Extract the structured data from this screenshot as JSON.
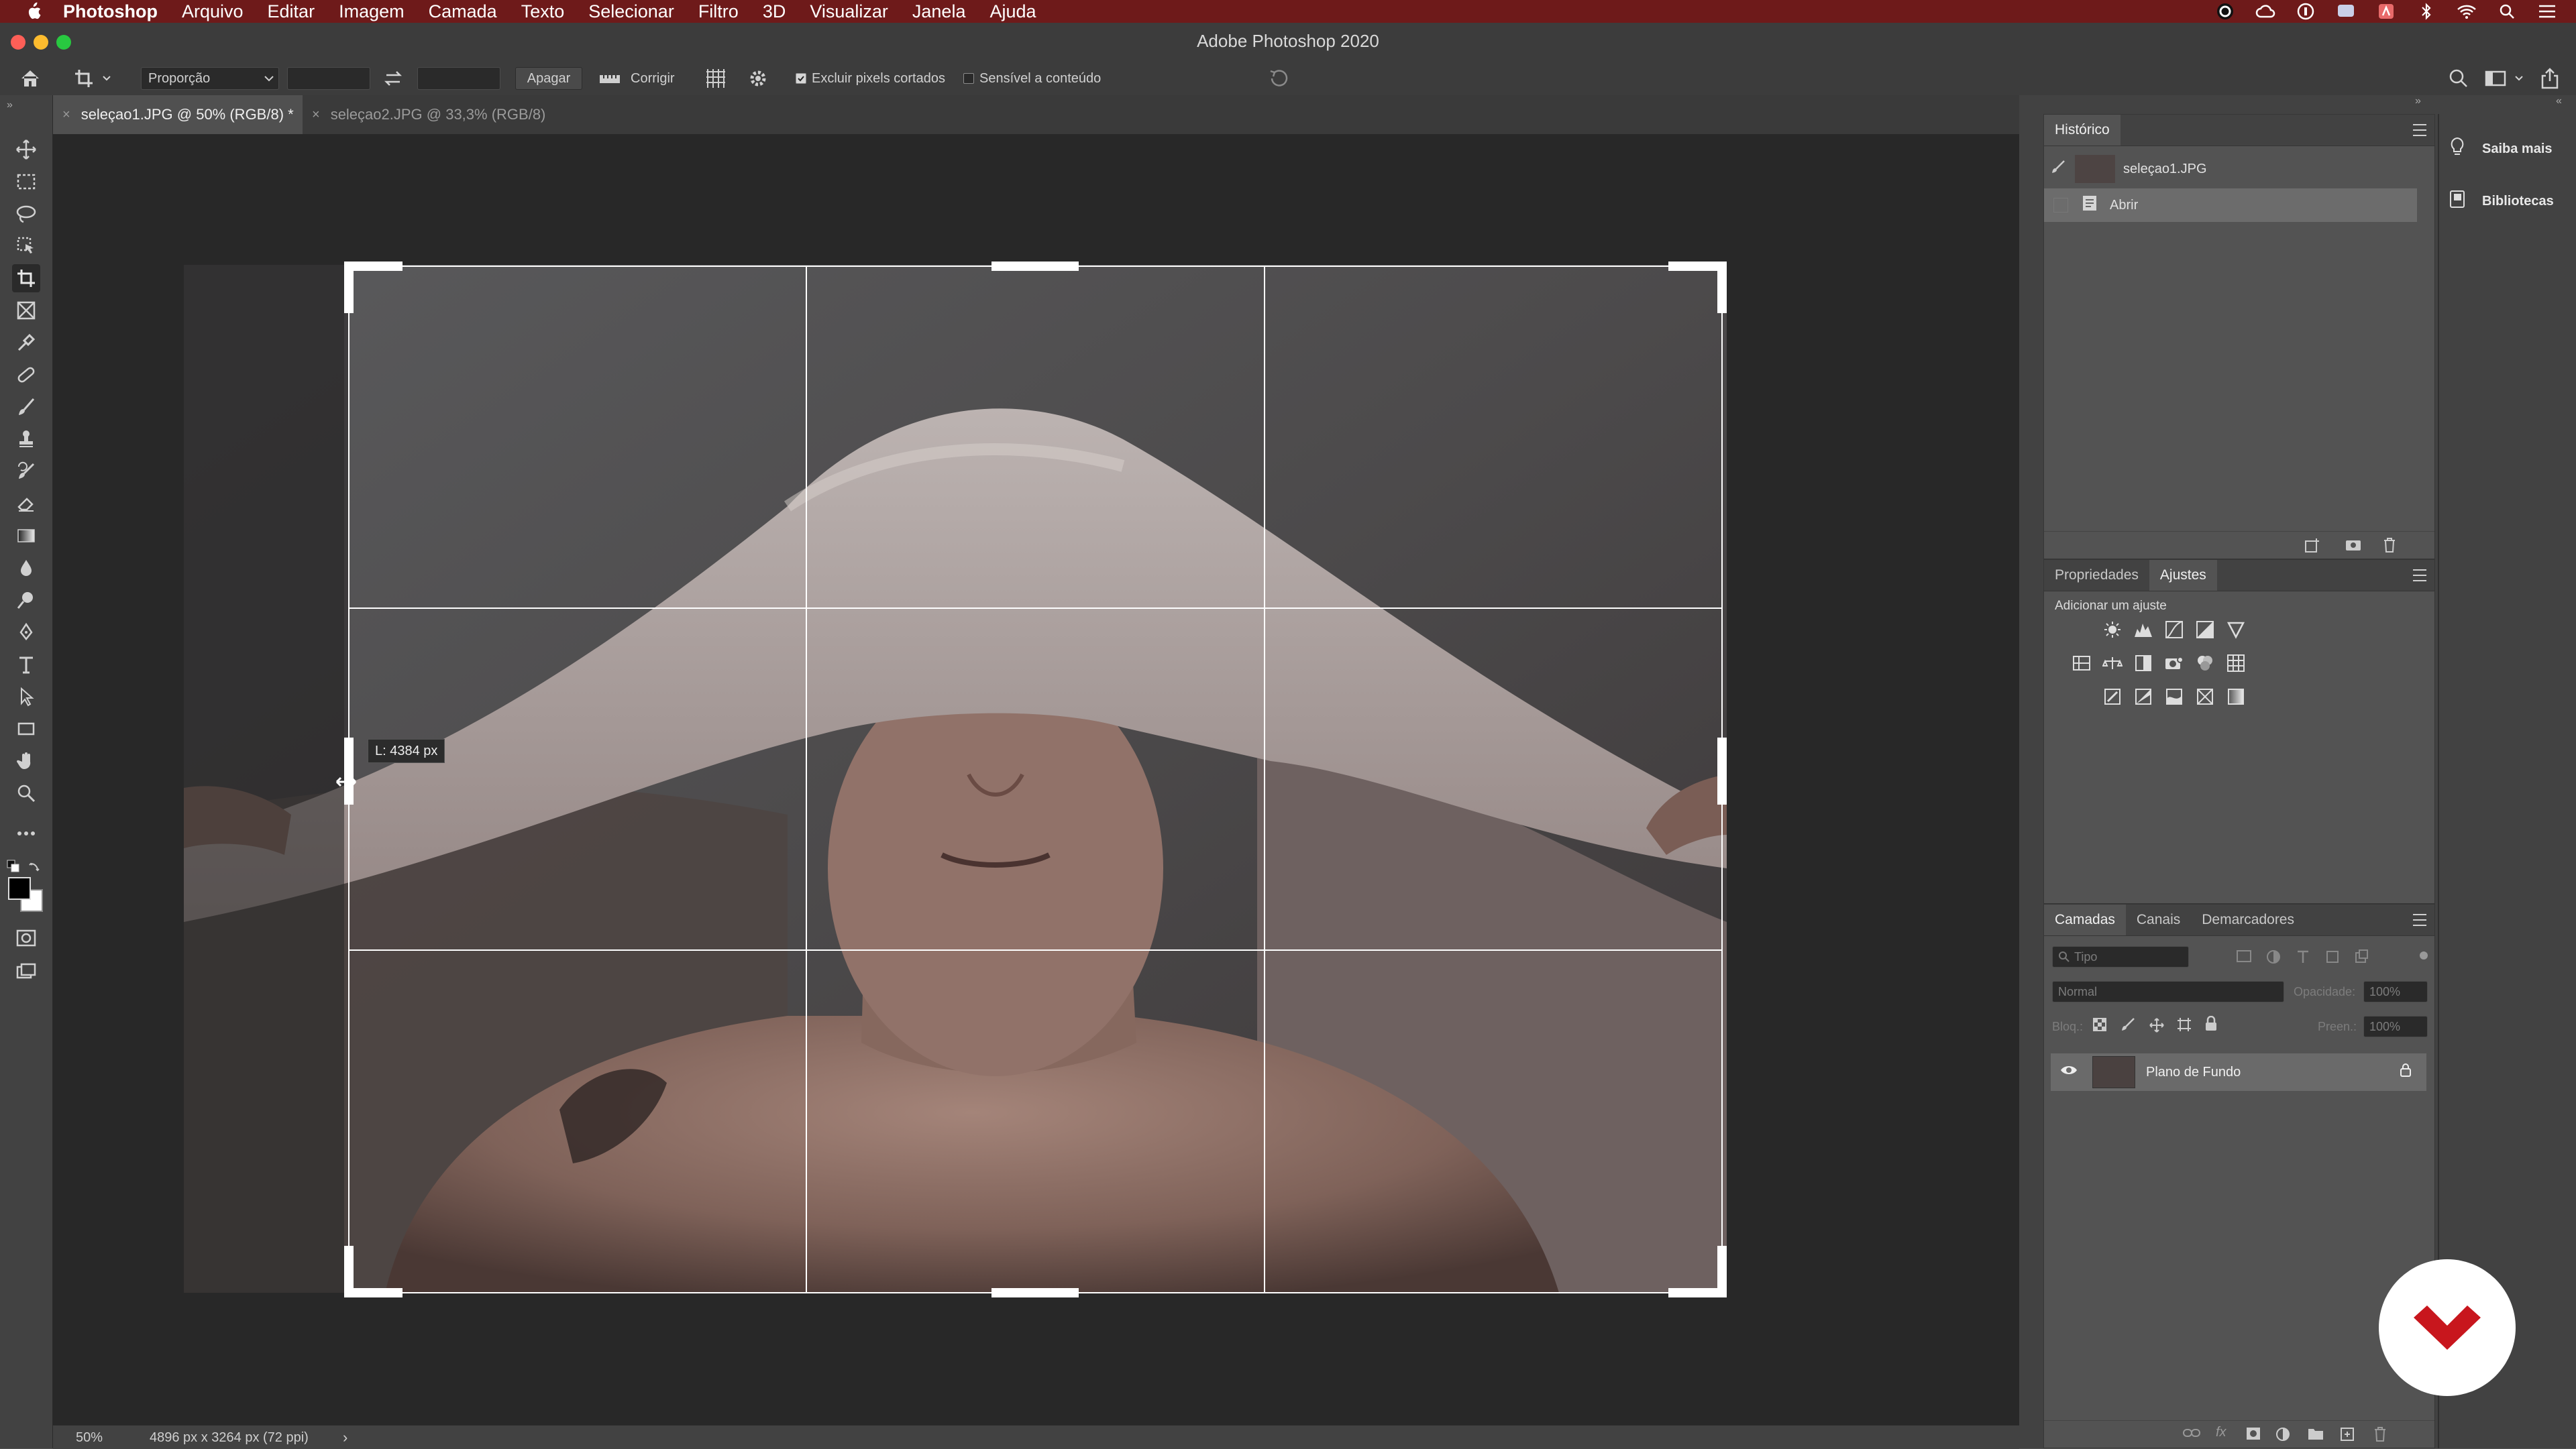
{
  "menubar": {
    "items": [
      "Photoshop",
      "Arquivo",
      "Editar",
      "Imagem",
      "Camada",
      "Texto",
      "Selecionar",
      "Filtro",
      "3D",
      "Visualizar",
      "Janela",
      "Ajuda"
    ],
    "status_icons": [
      "creative-cloud-icon",
      "cc-sync-icon",
      "onepassword-icon",
      "screen-icon",
      "adobe-icon",
      "bluetooth-icon",
      "wifi-icon",
      "spotlight-icon",
      "control-center-icon"
    ],
    "color": "#6e1a1a"
  },
  "window": {
    "title": "Adobe Photoshop 2020"
  },
  "options_bar": {
    "ratio_select": "Proporção",
    "clear_button": "Apagar",
    "straighten_label": "Corrigir",
    "delete_cropped_label": "Excluir pixels cortados",
    "delete_cropped_checked": true,
    "content_aware_label": "Sensível a conteúdo",
    "content_aware_checked": false
  },
  "tabs": [
    {
      "label": "seleçao1.JPG @ 50% (RGB/8) *",
      "active": true
    },
    {
      "label": "seleçao2.JPG @ 33,3% (RGB/8)",
      "active": false
    }
  ],
  "canvas": {
    "crop_tooltip": "L: 4384 px",
    "background": "#282828"
  },
  "status": {
    "zoom": "50%",
    "doc_info": "4896 px x 3264 px (72 ppi)"
  },
  "historico": {
    "tab": "Histórico",
    "snapshot": "seleçao1.JPG",
    "steps": [
      "Abrir"
    ]
  },
  "adjustments": {
    "tabs": [
      "Propriedades",
      "Ajustes"
    ],
    "active_tab": "Ajustes",
    "heading": "Adicionar um ajuste"
  },
  "layers": {
    "tabs": [
      "Camadas",
      "Canais",
      "Demarcadores"
    ],
    "filter_placeholder": "Tipo",
    "blend_mode": "Normal",
    "opacity_label": "Opacidade:",
    "opacity_value": "100%",
    "lock_label": "Bloq.:",
    "fill_label": "Preen.:",
    "fill_value": "100%",
    "items": [
      {
        "name": "Plano de Fundo",
        "visible": true,
        "locked": true
      }
    ]
  },
  "side": {
    "learn": "Saiba mais",
    "libraries": "Bibliotecas"
  },
  "watermark": {
    "color": "#c8161d"
  }
}
